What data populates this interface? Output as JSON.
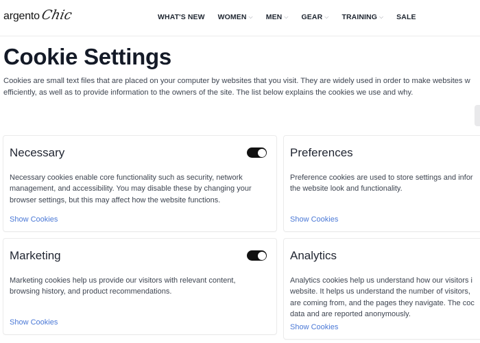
{
  "header": {
    "logo_main": "argento",
    "logo_script": "Chic",
    "nav": [
      {
        "label": "WHAT'S NEW",
        "has_dropdown": false
      },
      {
        "label": "WOMEN",
        "has_dropdown": true
      },
      {
        "label": "MEN",
        "has_dropdown": true
      },
      {
        "label": "GEAR",
        "has_dropdown": true
      },
      {
        "label": "TRAINING",
        "has_dropdown": true
      },
      {
        "label": "SALE",
        "has_dropdown": false
      }
    ],
    "chevron_glyph": "⌵"
  },
  "page": {
    "title": "Cookie Settings",
    "intro_line1": "Cookies are small text files that are placed on your computer by websites that you visit. They are widely used in order to make websites w",
    "intro_line2": "efficiently, as well as to provide information to the owners of the site. The list below explains the cookies we use and why."
  },
  "cards": [
    {
      "title": "Necessary",
      "toggle_on": true,
      "desc_lines": [
        "Necessary cookies enable core functionality such as security, network",
        "management, and accessibility. You may disable these by changing your",
        "browser settings, but this may affect how the website functions."
      ],
      "link": "Show Cookies"
    },
    {
      "title": "Preferences",
      "toggle_on": null,
      "desc_lines": [
        "Preference cookies are used to store settings and infor",
        "the website look and functionality."
      ],
      "link": "Show Cookies"
    },
    {
      "title": "Marketing",
      "toggle_on": true,
      "desc_lines": [
        "Marketing cookies help us provide our visitors with relevant content,",
        "browsing history, and product recommendations."
      ],
      "link": "Show Cookies"
    },
    {
      "title": "Analytics",
      "toggle_on": null,
      "desc_lines": [
        "Analytics cookies help us understand how our visitors i",
        "website. It helps us understand the number of visitors,",
        "are coming from, and the pages they navigate. The coc",
        "data and are reported anonymously."
      ],
      "link": "Show Cookies"
    }
  ],
  "colors": {
    "link": "#4a78d6",
    "toggle_on": "#111111",
    "title": "#141a27"
  }
}
